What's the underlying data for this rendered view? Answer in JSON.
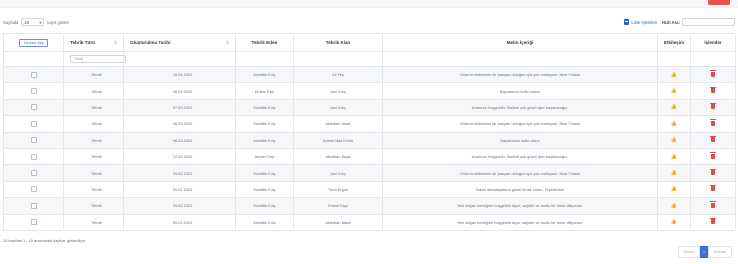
{
  "controls": {
    "length_prefix": "Sayfada",
    "length_value": "10",
    "length_suffix": "kayıt göster",
    "excel_label": "Liste İşlemleri",
    "search_label": "Hızlı Ara:"
  },
  "table": {
    "select_all_label": "Tümünü Seç",
    "columns": [
      "Tebrik Türü",
      "Oluşturulma Tarihi",
      "Tebrik Eden",
      "Tebrik Alan",
      "Metin İçeriği",
      "Etkileşim",
      "İşlemler"
    ],
    "filter_placeholder": "Tümü",
    "rows": [
      {
        "type": "Tebrik",
        "date": "15.04.2024",
        "from": "Muhittin Kılıç",
        "to": "Ali Yeş",
        "text": "Yıllardır ekibimizin bir parçası olduğun için çok mutluyum. Nice Yıllara!"
      },
      {
        "type": "Tebrik",
        "date": "08.04.2024",
        "from": "Emine Eşçi",
        "to": "Anıl Kılıç",
        "text": "Bayramınız kutlu olsun!"
      },
      {
        "type": "Tebrik",
        "date": "07.03.2024",
        "from": "Muhittin Kılıç",
        "to": "Anıl Kılıç",
        "text": "Aramıza Hoşgeldin. Sizlikle çok güzel işler başaracağız."
      },
      {
        "type": "Tebrik",
        "date": "06.03.2024",
        "from": "Muhittin Kılıç",
        "to": "Abdullah Ilawe",
        "text": "Yıllardır ekibimizin bir parçası olduğun için çok mutluyum. Nice Yıllara!"
      },
      {
        "type": "Tebrik",
        "date": "06.03.2024",
        "from": "Muhittin Kılıç",
        "to": "Ahmet Naz Kılınlı",
        "text": "Bayramınız kutlu olsun"
      },
      {
        "type": "Tebrik",
        "date": "12.02.2024",
        "from": "Ahmet Turp",
        "to": "Melahan Kaya",
        "text": "Aramıza Hoşgeldin. Sizlikle çok güzel işler başaracağız."
      },
      {
        "type": "Tebrik",
        "date": "09.02.2024",
        "from": "Muhittin Kılıç",
        "to": "Anıl Kılıç",
        "text": "Yıllardır ekibimizin bir parçası olduğun için çok mutluyum. Nice Yıllara!"
      },
      {
        "type": "Tebrik",
        "date": "09.02.2024",
        "from": "Muhittin Kılıç",
        "to": "Tuba Ergun",
        "text": "Takım arkadaşlarına güzel örnek oldun. Teşekkürler"
      },
      {
        "type": "Tebrik",
        "date": "09.02.2024",
        "from": "Muhittin Kılıç",
        "to": "Emine Eşçi",
        "text": "Yeni doğan bebeğine hoşgeldin diyor, sağlıklı ve mutlu bir ömür diliyorum."
      },
      {
        "type": "Tebrik",
        "date": "09.02.2024",
        "from": "Muhittin Kılıç",
        "to": "Abdullah Ilawe",
        "text": "Yeni doğan bebeğine hoşgeldin diyor, sağlıklı ve mutlu bir ömür diliyorum."
      }
    ]
  },
  "footer": {
    "info": "13 kayıttan 1 - 10 arasındaki kayıtlar gösteriliyor",
    "prev": "Önceki",
    "page": "1",
    "next": "Sonraki"
  },
  "colors": {
    "accent": "#3d6fd6",
    "danger": "#e24a4a",
    "topbar_red": "#e6534d"
  },
  "icons": {
    "excel": "excel-icon",
    "like": "thumbs-up-icon",
    "delete": "trash-icon"
  }
}
